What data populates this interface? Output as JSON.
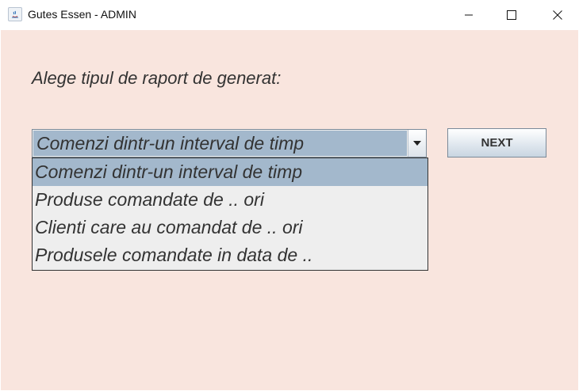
{
  "window": {
    "title": "Gutes Essen - ADMIN",
    "controls": [
      "minimize-icon",
      "maximize-icon",
      "close-icon"
    ]
  },
  "content": {
    "prompt": "Alege tipul de raport de generat:",
    "report_select": {
      "selected": "Comenzi dintr-un interval de timp",
      "options": [
        "Comenzi dintr-un interval de timp",
        "Produse comandate de .. ori",
        "Clienti care au comandat de .. ori",
        "Produsele comandate in data de .."
      ]
    },
    "next_label": "NEXT"
  },
  "colors": {
    "background": "#f9e5de",
    "selection": "#a3b8cc",
    "text": "#333333"
  }
}
